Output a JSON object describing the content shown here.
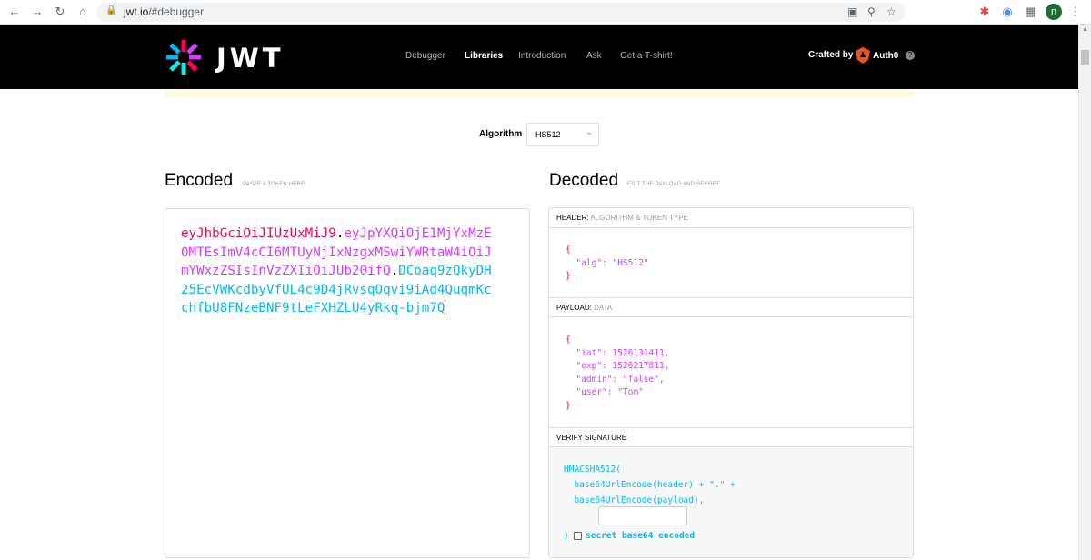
{
  "browser": {
    "url_host": "jwt.io",
    "url_path": "/#debugger",
    "profile_initial": "n"
  },
  "header": {
    "logo_text": "JWT",
    "nav": [
      "Debugger",
      "Libraries",
      "Introduction",
      "Ask",
      "Get a T-shirt!"
    ],
    "active_nav": "Libraries",
    "crafted_by": "Crafted by",
    "brand": "Auth0"
  },
  "algorithm": {
    "label": "Algorithm",
    "selected": "HS512"
  },
  "encoded": {
    "title": "Encoded",
    "subtitle": "PASTE A TOKEN HERE",
    "lines": [
      [
        {
          "t": "eyJhbGciOiJIUzUxMiJ9",
          "c": "header"
        },
        {
          "t": ".",
          "c": "dot"
        },
        {
          "t": "eyJpYXQiOjE1MjYxMzE",
          "c": "payload"
        }
      ],
      [
        {
          "t": "0MTEsImV4cCI6MTUyNjIxNzgxMSwiYWRtaW4iOiJ",
          "c": "payload"
        }
      ],
      [
        {
          "t": "mYWxzZSIsInVzZXIiOiJUb20ifQ",
          "c": "payload"
        },
        {
          "t": ".",
          "c": "dot"
        },
        {
          "t": "DCoaq9zQkyDH",
          "c": "sig"
        }
      ],
      [
        {
          "t": "25EcVWKcdbyVfUL4c9D4jRvsqOqvi9iAd4QuqmKc",
          "c": "sig"
        }
      ],
      [
        {
          "t": "chfbU8FNzeBNF9tLeFXHZLU4yRkq-bjm7Q",
          "c": "sig"
        }
      ]
    ]
  },
  "decoded": {
    "title": "Decoded",
    "subtitle": "EDIT THE PAYLOAD AND SECRET",
    "header_section": {
      "label": "HEADER:",
      "sublabel": "ALGORITHM & TOKEN TYPE",
      "open": "{",
      "lines": [
        "  \"alg\": \"HS512\""
      ],
      "close": "}"
    },
    "payload_section": {
      "label": "PAYLOAD:",
      "sublabel": "DATA",
      "open": "{",
      "lines": [
        "  \"iat\": 1526131411,",
        "  \"exp\": 1526217811,",
        "  \"admin\": \"false\",",
        "  \"user\": \"Tom\""
      ],
      "close": "}"
    },
    "signature_section": {
      "label": "VERIFY SIGNATURE",
      "code_lines": [
        "HMACSHA512(",
        "  base64UrlEncode(header) + \".\" +",
        "  base64UrlEncode(payload),"
      ],
      "secret_value": "",
      "close": ")",
      "checkbox_label": "secret base64 encoded",
      "checkbox_checked": false
    }
  }
}
